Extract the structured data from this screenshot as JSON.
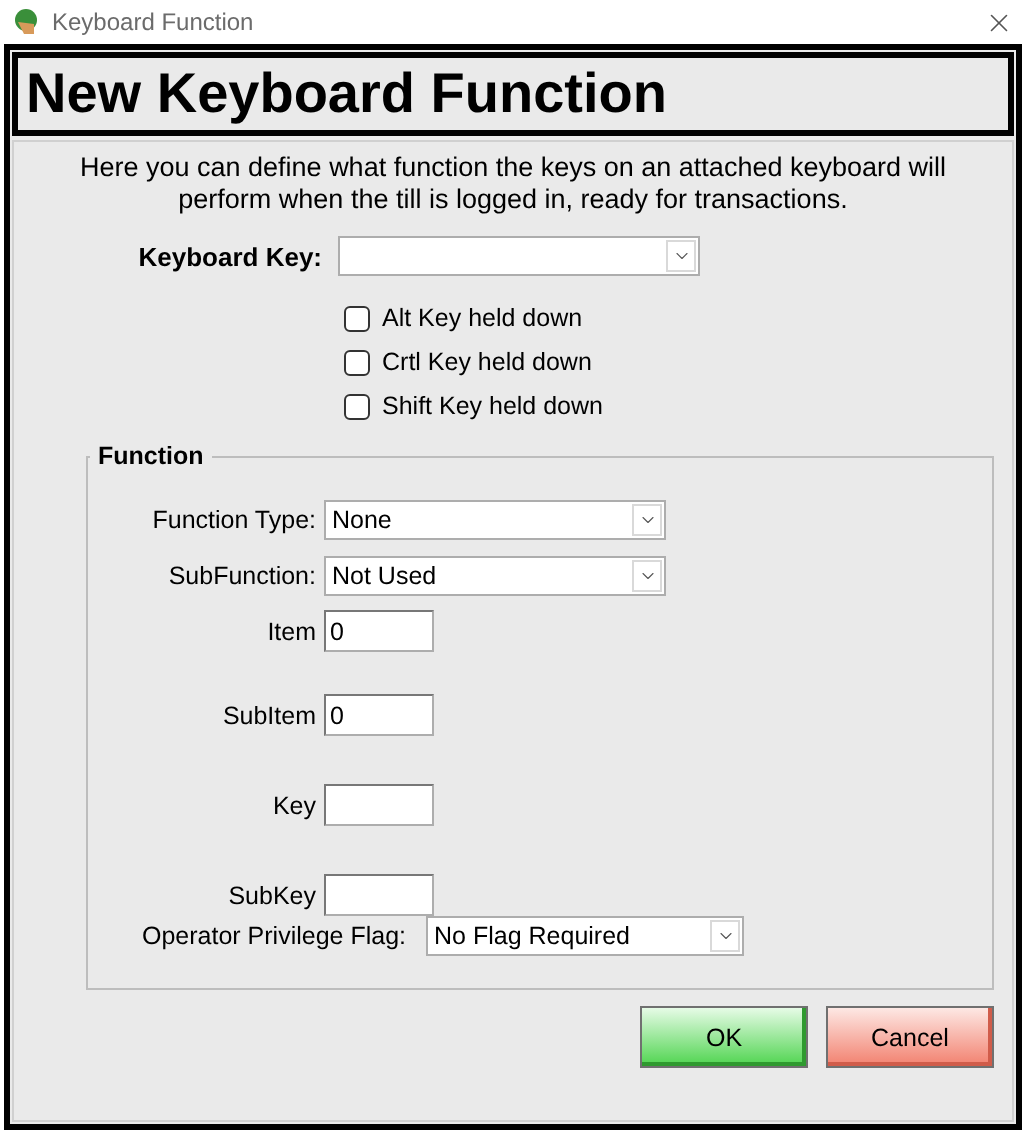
{
  "window": {
    "title": "Keyboard Function"
  },
  "header": "New Keyboard Function",
  "intro": "Here you can define what function the keys on an attached keyboard will perform when the till is logged in, ready for transactions.",
  "keyboard_key": {
    "label": "Keyboard Key:"
  },
  "modifiers": [
    {
      "label": "Alt Key held down",
      "checked": false
    },
    {
      "label": "Crtl Key held down",
      "checked": false
    },
    {
      "label": "Shift Key held down",
      "checked": false
    }
  ],
  "function_group": {
    "title": "Function",
    "fields": [
      {
        "kind": "combo",
        "label": "Function Type:",
        "value": "None"
      },
      {
        "kind": "combo",
        "label": "SubFunction:",
        "value": "Not Used"
      },
      {
        "kind": "text",
        "label": "Item",
        "value": "0"
      },
      {
        "kind": "text",
        "label": "SubItem",
        "value": "0"
      },
      {
        "kind": "text",
        "label": "Key"
      },
      {
        "kind": "text",
        "label": "SubKey"
      }
    ],
    "privilege": {
      "label": "Operator Privilege Flag:",
      "value": "No Flag Required"
    }
  },
  "buttons": [
    {
      "kind": "ok",
      "label": "OK"
    },
    {
      "kind": "cancel",
      "label": "Cancel"
    }
  ]
}
